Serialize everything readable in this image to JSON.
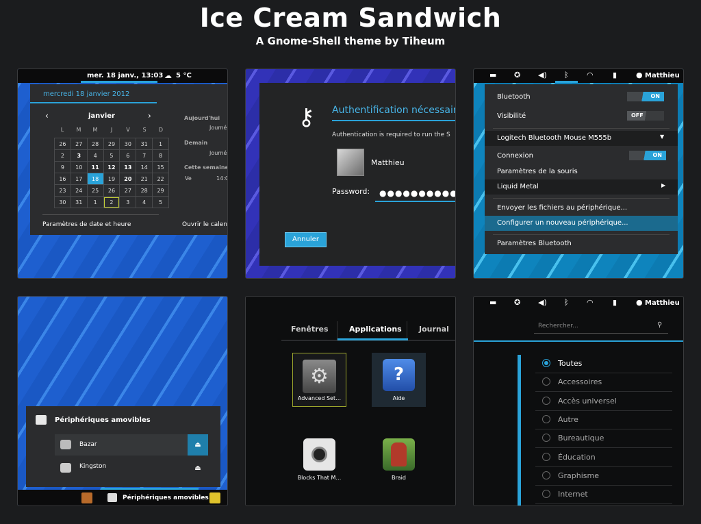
{
  "header": {
    "title": "Ice Cream Sandwich",
    "subtitle": "A Gnome-Shell theme by Tiheum"
  },
  "calendar": {
    "clock": "mer. 18 janv., 13:03",
    "weather": "5 °C",
    "date_heading": "mercredi 18 janvier 2012",
    "month": "janvier",
    "weekdays": [
      "L",
      "M",
      "M",
      "J",
      "V",
      "S",
      "D"
    ],
    "weeks": [
      [
        "26",
        "27",
        "28",
        "29",
        "30",
        "31",
        "1"
      ],
      [
        "2",
        "3",
        "4",
        "5",
        "6",
        "7",
        "8"
      ],
      [
        "9",
        "10",
        "11",
        "12",
        "13",
        "14",
        "15"
      ],
      [
        "16",
        "17",
        "18",
        "19",
        "20",
        "21",
        "22"
      ],
      [
        "23",
        "24",
        "25",
        "26",
        "27",
        "28",
        "29"
      ],
      [
        "30",
        "31",
        "1",
        "2",
        "3",
        "4",
        "5"
      ]
    ],
    "events": {
      "today": "Aujourd'hui",
      "today_val": "Journé",
      "tomorrow": "Demain",
      "tomorrow_val": "Journé",
      "week": "Cette semaine",
      "week_day": "Ve",
      "week_time": "14:0"
    },
    "settings_link": "Paramètres de date et heure",
    "open_link": "Ouvrir le calen"
  },
  "auth": {
    "title": "Authentification nécessaire",
    "message": "Authentication is required to run the S",
    "user": "Matthieu",
    "password_label": "Password:",
    "password_value": "●●●●●●●●●●●",
    "cancel": "Annuler"
  },
  "bluetooth": {
    "user": "Matthieu",
    "bt_label": "Bluetooth",
    "bt_state": "ON",
    "vis_label": "Visibilité",
    "vis_state": "OFF",
    "device1": "Logitech Bluetooth Mouse M555b",
    "conn_label": "Connexion",
    "conn_state": "ON",
    "mouse_settings": "Paramètres de la souris",
    "device2": "Liquid Metal",
    "send_files": "Envoyer les fichiers au périphérique...",
    "configure": "Configurer un nouveau périphérique...",
    "bt_settings": "Paramètres Bluetooth"
  },
  "removable": {
    "title": "Périphériques amovibles",
    "items": [
      "Bazar",
      "Kingston"
    ],
    "taskbar_label": "Périphériques amovibles"
  },
  "apps": {
    "tabs": [
      "Fenêtres",
      "Applications",
      "Journal"
    ],
    "items": [
      "Advanced Set…",
      "Aide",
      "Blocks That M…",
      "Braid"
    ]
  },
  "categories": {
    "user": "Matthieu",
    "search_placeholder": "Rechercher...",
    "items": [
      "Toutes",
      "Accessoires",
      "Accès universel",
      "Autre",
      "Bureautique",
      "Éducation",
      "Graphisme",
      "Internet"
    ]
  },
  "colors": {
    "accent": "#2aa3d9",
    "background": "#1b1c1e"
  }
}
